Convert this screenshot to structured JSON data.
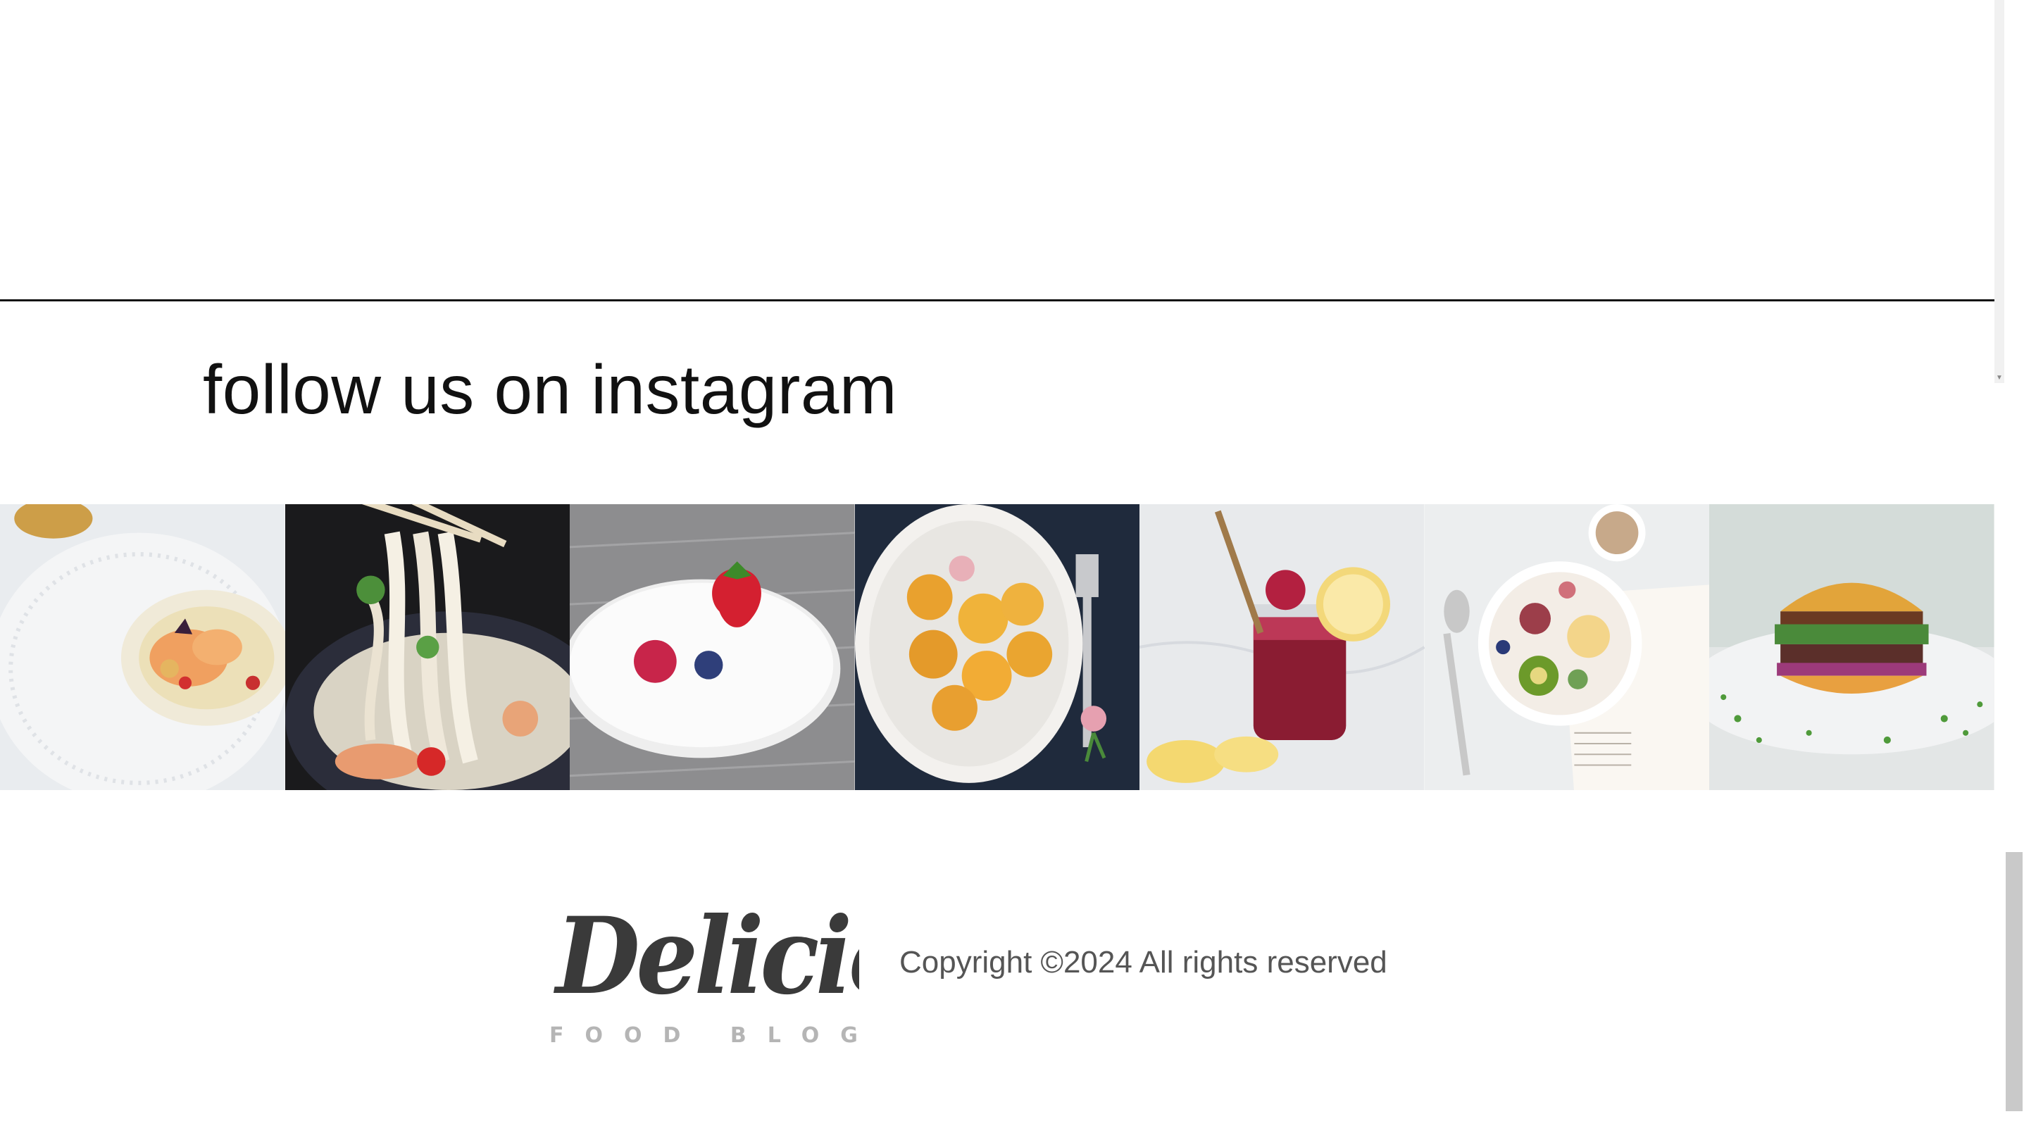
{
  "instagram": {
    "title": "follow us on instagram",
    "photos": [
      {
        "label": "shrimp-bisque-plate"
      },
      {
        "label": "noodle-soup-bowl"
      },
      {
        "label": "berries-on-plate"
      },
      {
        "label": "apricots-plate"
      },
      {
        "label": "berry-lemonade-jar"
      },
      {
        "label": "fruit-yogurt-bowl"
      },
      {
        "label": "veggie-burger"
      }
    ]
  },
  "footer": {
    "logo_main": "Delicious",
    "logo_sub": "FOOD BLOG",
    "copyright": "Copyright ©2024 All rights reserved"
  },
  "colors": {
    "title_text": "#111111",
    "copyright_text": "#555555",
    "logo_main": "#3a3a3a",
    "logo_sub": "#b5b5b5",
    "scroll_thumb": "#c9c9c9"
  }
}
